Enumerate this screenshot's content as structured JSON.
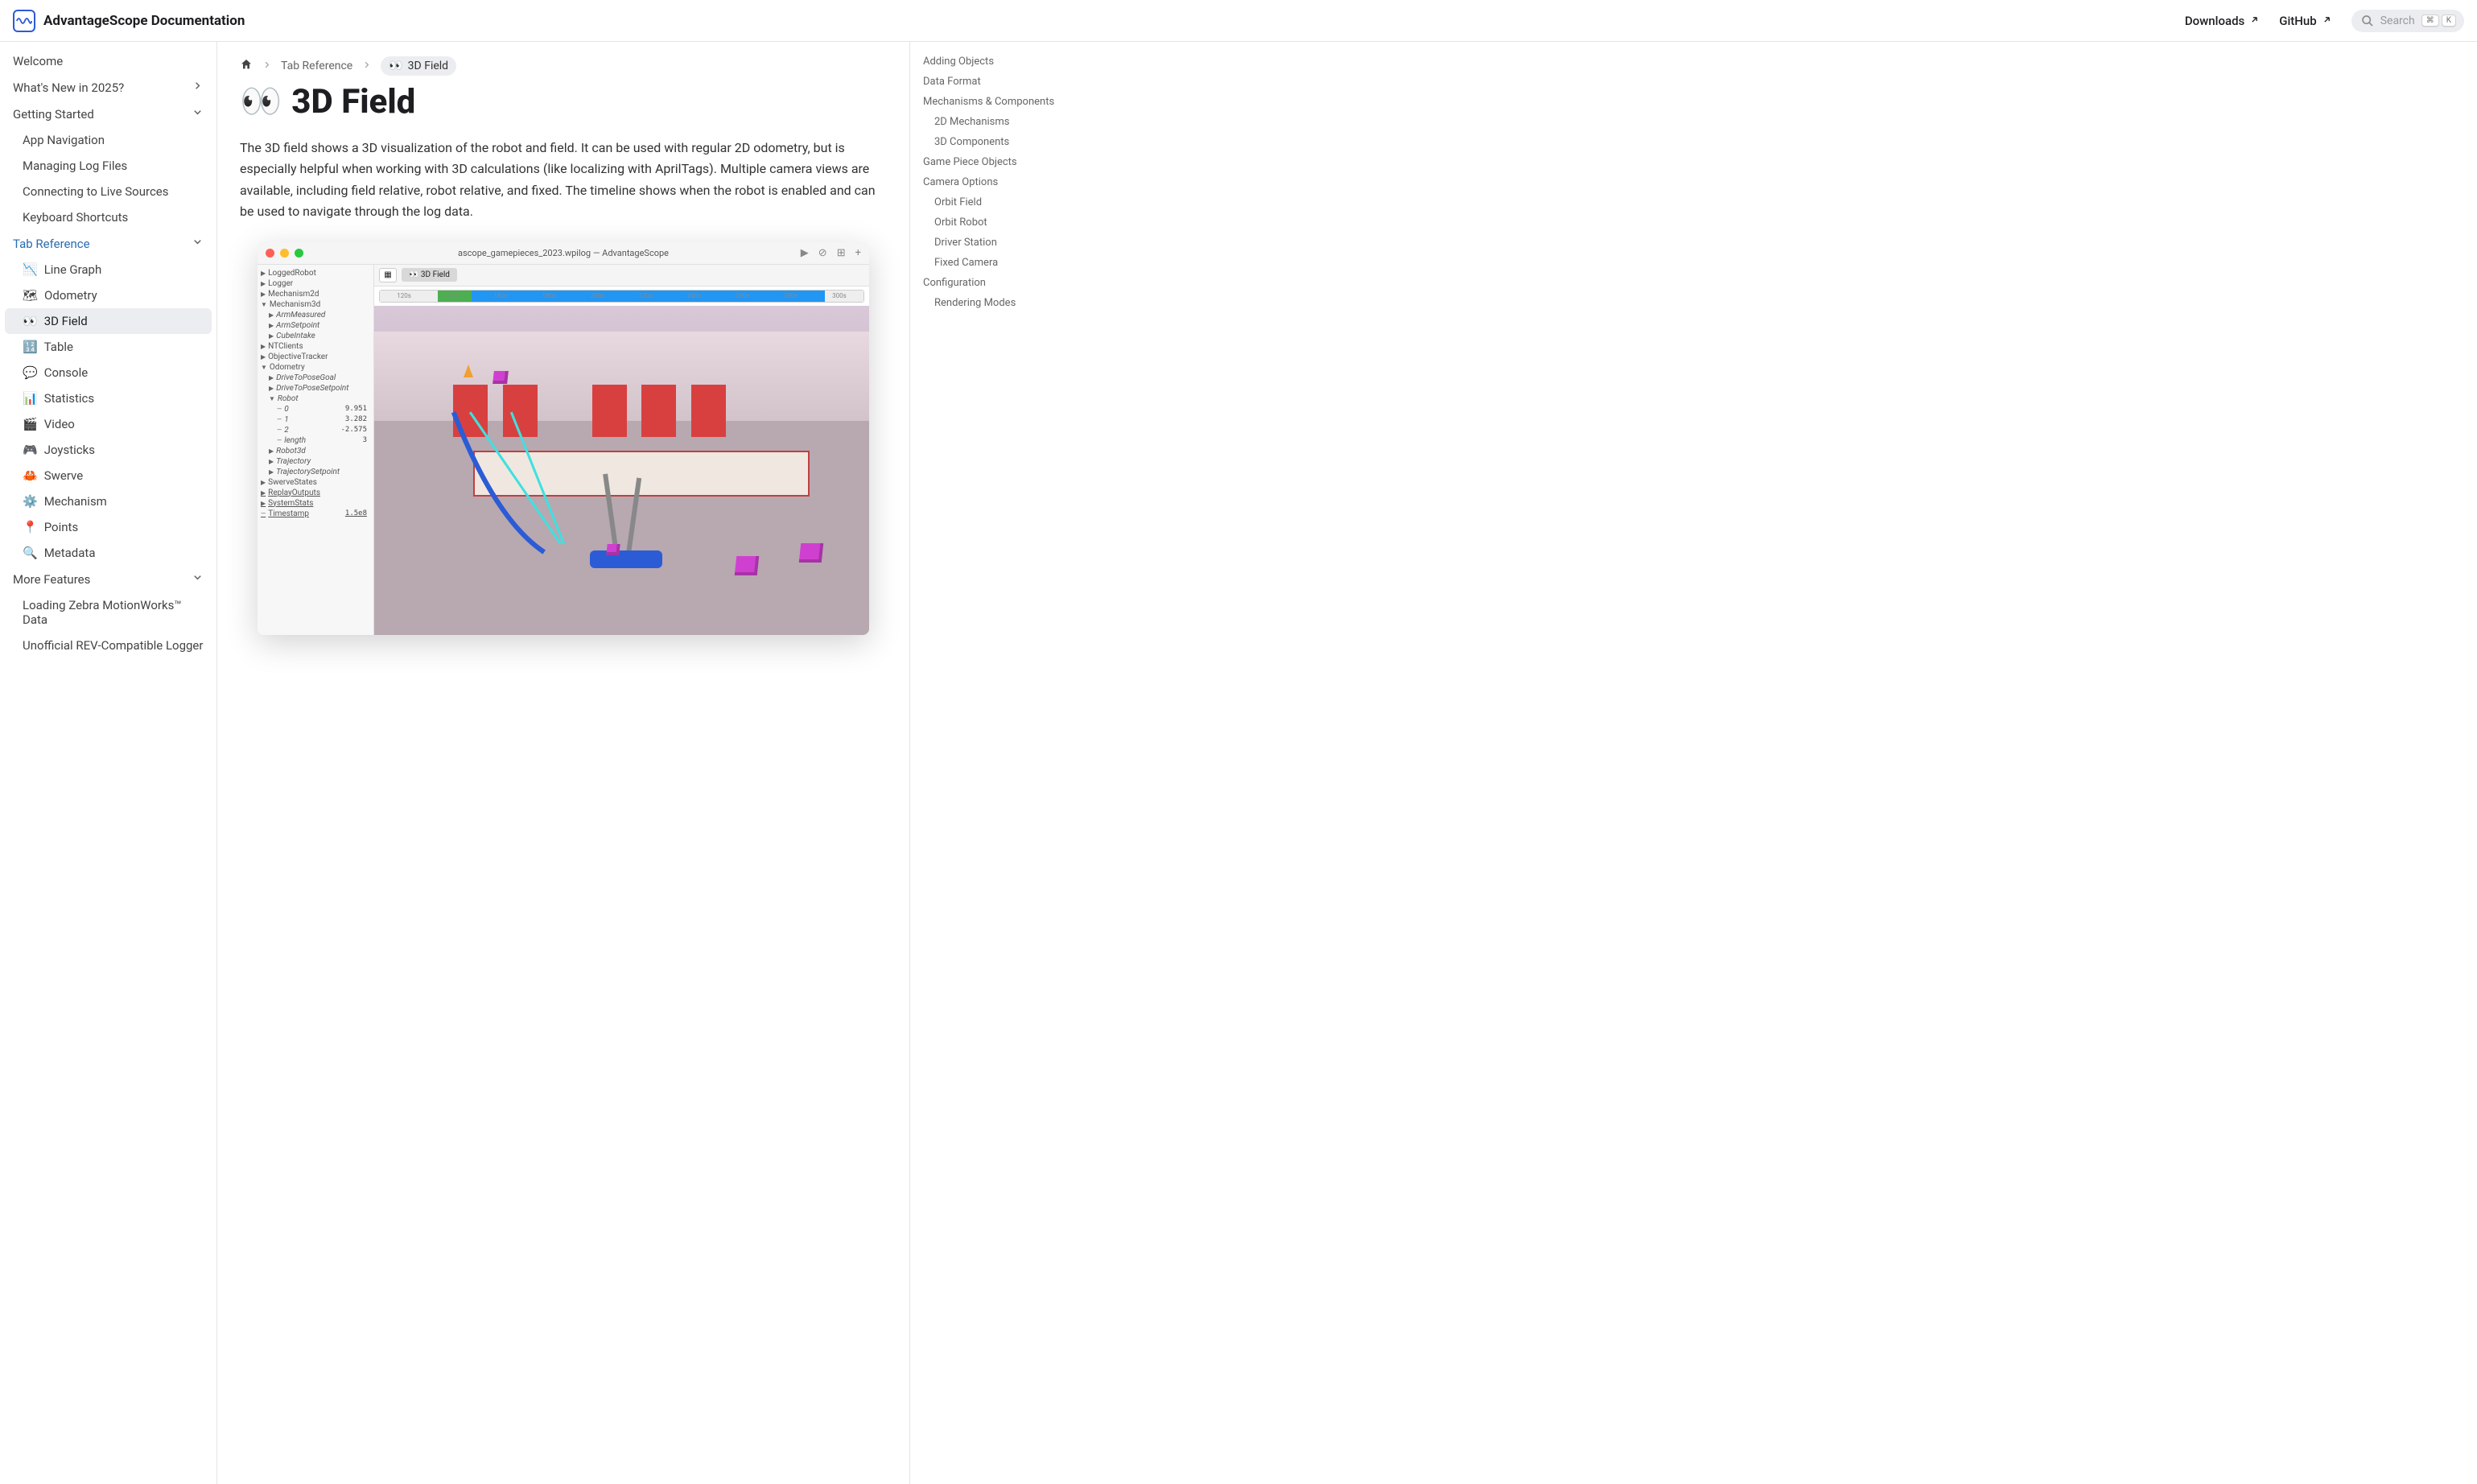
{
  "navbar": {
    "title": "AdvantageScope Documentation",
    "links": [
      {
        "label": "Downloads",
        "external": true
      },
      {
        "label": "GitHub",
        "external": true
      }
    ],
    "search_placeholder": "Search",
    "search_keys": [
      "⌘",
      "K"
    ]
  },
  "sidebar": [
    {
      "label": "Welcome",
      "level": 0
    },
    {
      "label": "What's New in 2025?",
      "level": 0,
      "chev": "right"
    },
    {
      "label": "Getting Started",
      "level": 0,
      "chev": "down"
    },
    {
      "label": "App Navigation",
      "level": 1
    },
    {
      "label": "Managing Log Files",
      "level": 1
    },
    {
      "label": "Connecting to Live Sources",
      "level": 1
    },
    {
      "label": "Keyboard Shortcuts",
      "level": 1
    },
    {
      "label": "Tab Reference",
      "level": 0,
      "chev": "down",
      "active_cat": true
    },
    {
      "emoji": "📉",
      "label": "Line Graph",
      "level": 1
    },
    {
      "emoji": "🗺",
      "label": "Odometry",
      "level": 1
    },
    {
      "emoji": "👀",
      "label": "3D Field",
      "level": 1,
      "active": true
    },
    {
      "emoji": "🔢",
      "label": "Table",
      "level": 1
    },
    {
      "emoji": "💬",
      "label": "Console",
      "level": 1
    },
    {
      "emoji": "📊",
      "label": "Statistics",
      "level": 1
    },
    {
      "emoji": "🎬",
      "label": "Video",
      "level": 1
    },
    {
      "emoji": "🎮",
      "label": "Joysticks",
      "level": 1
    },
    {
      "emoji": "🦀",
      "label": "Swerve",
      "level": 1
    },
    {
      "emoji": "⚙️",
      "label": "Mechanism",
      "level": 1
    },
    {
      "emoji": "📍",
      "label": "Points",
      "level": 1
    },
    {
      "emoji": "🔍",
      "label": "Metadata",
      "level": 1
    },
    {
      "label": "More Features",
      "level": 0,
      "chev": "down"
    },
    {
      "label": "Loading Zebra MotionWorks™ Data",
      "level": 1
    },
    {
      "label": "Unofficial REV-Compatible Logger",
      "level": 1
    }
  ],
  "breadcrumb": {
    "items": [
      "Tab Reference"
    ],
    "current_emoji": "👀",
    "current": "3D Field"
  },
  "page": {
    "heading_emoji": "👀",
    "heading": "3D Field",
    "intro": "The 3D field shows a 3D visualization of the robot and field. It can be used with regular 2D odometry, but is especially helpful when working with 3D calculations (like localizing with AprilTags). Multiple camera views are available, including field relative, robot relative, and fixed. The timeline shows when the robot is enabled and can be used to navigate through the log data."
  },
  "screenshot": {
    "window_title": "ascope_gamepieces_2023.wpilog — AdvantageScope",
    "toolbar_icons": [
      "▶",
      "⊘",
      "⊞",
      "+"
    ],
    "tab_label": "👀 3D Field",
    "timeline_labels": [
      "120s",
      "140s",
      "160s",
      "180s",
      "200s",
      "220s",
      "240s",
      "260s",
      "280s",
      "300s"
    ],
    "tree": [
      {
        "ind": 0,
        "tri": "▶",
        "label": "LoggedRobot"
      },
      {
        "ind": 0,
        "tri": "▶",
        "label": "Logger"
      },
      {
        "ind": 0,
        "tri": "▶",
        "label": "Mechanism2d"
      },
      {
        "ind": 0,
        "tri": "▼",
        "label": "Mechanism3d"
      },
      {
        "ind": 1,
        "tri": "▶",
        "label": "ArmMeasured"
      },
      {
        "ind": 1,
        "tri": "▶",
        "label": "ArmSetpoint"
      },
      {
        "ind": 1,
        "tri": "▶",
        "label": "CubeIntake"
      },
      {
        "ind": 0,
        "tri": "▶",
        "label": "NTClients"
      },
      {
        "ind": 0,
        "tri": "▶",
        "label": "ObjectiveTracker"
      },
      {
        "ind": 0,
        "tri": "▼",
        "label": "Odometry"
      },
      {
        "ind": 1,
        "tri": "▶",
        "label": "DriveToPoseGoal"
      },
      {
        "ind": 1,
        "tri": "▶",
        "label": "DriveToPoseSetpoint"
      },
      {
        "ind": 1,
        "tri": "▼",
        "label": "Robot"
      },
      {
        "ind": 2,
        "tri": "—",
        "label": "0",
        "val": "9.951"
      },
      {
        "ind": 2,
        "tri": "—",
        "label": "1",
        "val": "3.282"
      },
      {
        "ind": 2,
        "tri": "—",
        "label": "2",
        "val": "-2.575"
      },
      {
        "ind": 2,
        "tri": "—",
        "label": "length",
        "val": "3"
      },
      {
        "ind": 1,
        "tri": "▶",
        "label": "Robot3d"
      },
      {
        "ind": 1,
        "tri": "▶",
        "label": "Trajectory"
      },
      {
        "ind": 1,
        "tri": "▶",
        "label": "TrajectorySetpoint"
      },
      {
        "ind": 0,
        "tri": "▶",
        "label": "SwerveStates"
      },
      {
        "ind": 0,
        "tri": "▶",
        "label": "ReplayOutputs",
        "ul": true
      },
      {
        "ind": 0,
        "tri": "▶",
        "label": "SystemStats",
        "ul": true
      },
      {
        "ind": 0,
        "tri": "—",
        "label": "Timestamp",
        "val": "1.5e8",
        "ul": true
      }
    ]
  },
  "toc": [
    {
      "label": "Adding Objects",
      "level": 1
    },
    {
      "label": "Data Format",
      "level": 1
    },
    {
      "label": "Mechanisms & Components",
      "level": 1
    },
    {
      "label": "2D Mechanisms",
      "level": 2
    },
    {
      "label": "3D Components",
      "level": 2
    },
    {
      "label": "Game Piece Objects",
      "level": 1
    },
    {
      "label": "Camera Options",
      "level": 1
    },
    {
      "label": "Orbit Field",
      "level": 2
    },
    {
      "label": "Orbit Robot",
      "level": 2
    },
    {
      "label": "Driver Station",
      "level": 2
    },
    {
      "label": "Fixed Camera",
      "level": 2
    },
    {
      "label": "Configuration",
      "level": 1
    },
    {
      "label": "Rendering Modes",
      "level": 2
    }
  ]
}
